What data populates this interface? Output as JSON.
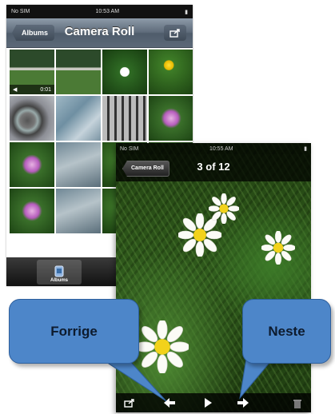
{
  "back_phone": {
    "status_bar": {
      "carrier": "No SIM",
      "time": "10:53 AM"
    },
    "nav": {
      "back_label": "Albums",
      "title": "Camera Roll"
    },
    "video_duration": "0:01",
    "tab_label": "Albums"
  },
  "front_phone": {
    "status_bar": {
      "carrier": "No SIM",
      "time": "10:55 AM"
    },
    "nav": {
      "back_label": "Camera Roll",
      "counter": "3 of 12"
    }
  },
  "callouts": {
    "previous": "Forrige",
    "next": "Neste"
  },
  "colors": {
    "callout": "#4d86c9",
    "nav_bar": "#5f6c7b"
  },
  "icons": [
    "share-icon",
    "previous-arrow-icon",
    "play-icon",
    "next-arrow-icon",
    "trash-icon",
    "albums-icon",
    "video-camera-icon"
  ]
}
